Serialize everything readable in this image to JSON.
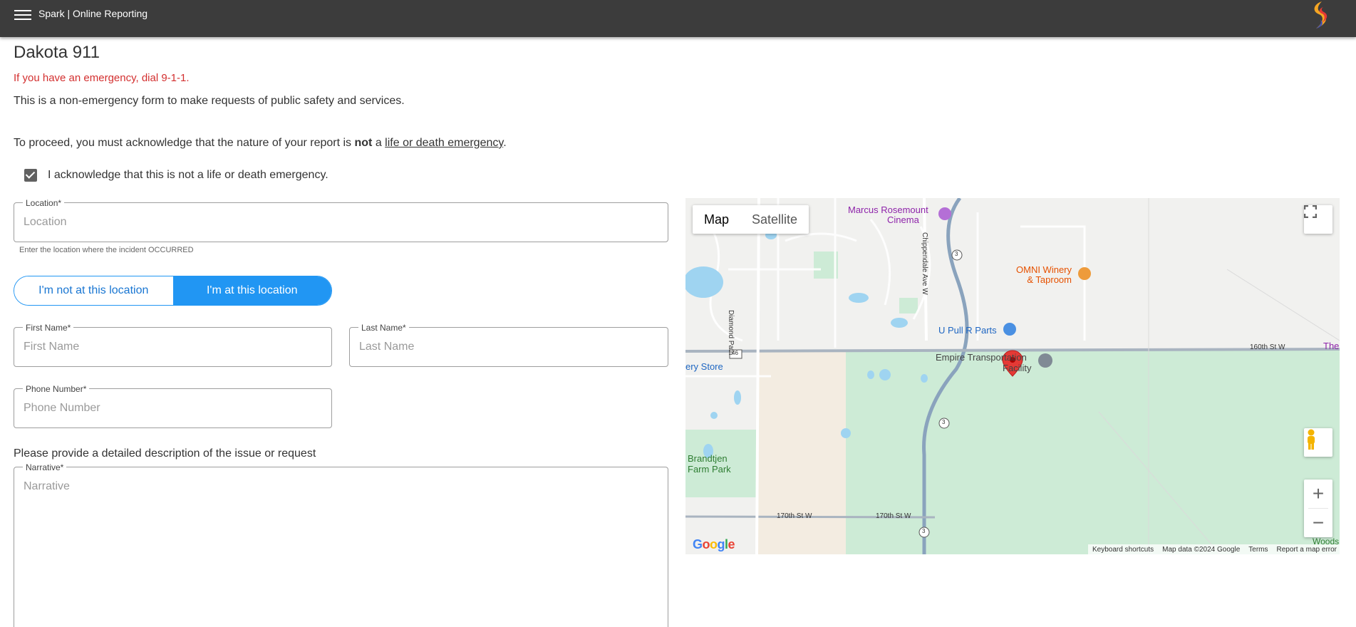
{
  "header": {
    "title": "Spark | Online Reporting"
  },
  "page": {
    "title": "Dakota 911",
    "emergency": "If you have an emergency, dial 9-1-1.",
    "intro": "This is a non-emergency form to make requests of public safety and services.",
    "proceed_pre": "To proceed, you must acknowledge that the nature of your report is ",
    "proceed_bold": "not",
    "proceed_mid": " a ",
    "proceed_link": "life or death emergency",
    "proceed_post": ".",
    "acknowledge_label": "I acknowledge that this is not a life or death emergency.",
    "acknowledged": true
  },
  "form": {
    "location": {
      "label": "Location*",
      "placeholder": "Location",
      "hint": "Enter the location where the incident OCCURRED"
    },
    "toggle": {
      "off_label": "I'm not at this location",
      "on_label": "I'm at this location",
      "selected": "on"
    },
    "first_name": {
      "label": "First Name*",
      "placeholder": "First Name"
    },
    "last_name": {
      "label": "Last Name*",
      "placeholder": "Last Name"
    },
    "phone": {
      "label": "Phone Number*",
      "placeholder": "Phone Number"
    },
    "description_prompt": "Please provide a detailed description of the issue or request",
    "narrative": {
      "label": "Narrative*",
      "placeholder": "Narrative"
    }
  },
  "map": {
    "type_map": "Map",
    "type_satellite": "Satellite",
    "labels": {
      "cinema_line1": "Marcus Rosemount",
      "cinema_line2": "Cinema",
      "winery_line1": "OMNI Winery",
      "winery_line2": "& Taproom",
      "upull": "U Pull R Parts",
      "empire_line1": "Empire Transportation",
      "empire_line2": "Facility",
      "store": "ery Store",
      "park_line1": "Brandtjen",
      "park_line2": "Farm Park",
      "street_160": "160th St W",
      "street_170a": "170th St W",
      "street_170b": "170th St W",
      "diamond": "Diamond Path",
      "chippendale": "Chippendale Ave W",
      "route3": "3",
      "route46": "46",
      "edge_the": "The",
      "edge_woods": "Woods"
    },
    "footer": {
      "shortcuts": "Keyboard shortcuts",
      "data": "Map data ©2024 Google",
      "terms": "Terms",
      "report": "Report a map error"
    },
    "google": "Google",
    "colors": {
      "park": "#c8ead4",
      "water": "#9ed3f0",
      "road": "#8aa3bd",
      "marker": "#e53935"
    }
  }
}
